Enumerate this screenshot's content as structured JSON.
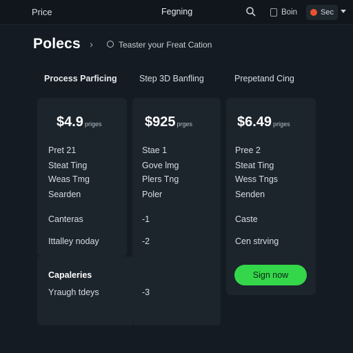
{
  "topbar": {
    "brand": "Price",
    "center": "Fegning",
    "user_label": "Boin",
    "account_label": "Sec"
  },
  "header": {
    "title": "Polecs",
    "breadcrumb_sep": "›",
    "breadcrumb_text": "Teaster your Freat Cation"
  },
  "columns": [
    {
      "heading": "Process Parficing",
      "price": "$4.9",
      "price_unit": "priges"
    },
    {
      "heading": "Step 3D Banfling",
      "price": "$925",
      "price_unit": "prges"
    },
    {
      "heading": "Prepetand Cing",
      "price": "$6.49",
      "price_unit": "priges"
    }
  ],
  "features": {
    "col1": [
      "Pret 21",
      "Steat Ting",
      "Weas Tmg",
      "Searden",
      "Canteras",
      "Ittalley noday"
    ],
    "col2": [
      "Stae 1",
      "Gove lmg",
      "Plers Tng",
      "Poler",
      "-1",
      "-2"
    ],
    "col3": [
      "Pree 2",
      "Steat Ting",
      "Wess Tngs",
      "Senden",
      "Caste",
      "Cen strving"
    ]
  },
  "capabilities": {
    "title": "Capaleries",
    "row_label": "Yraugh tdeys",
    "row_value": "-3"
  },
  "cta": {
    "label": "Sign now"
  },
  "colors": {
    "accent": "#34d64a",
    "background": "#141b22",
    "card": "#1c242c",
    "avatar": "#e8532e"
  }
}
